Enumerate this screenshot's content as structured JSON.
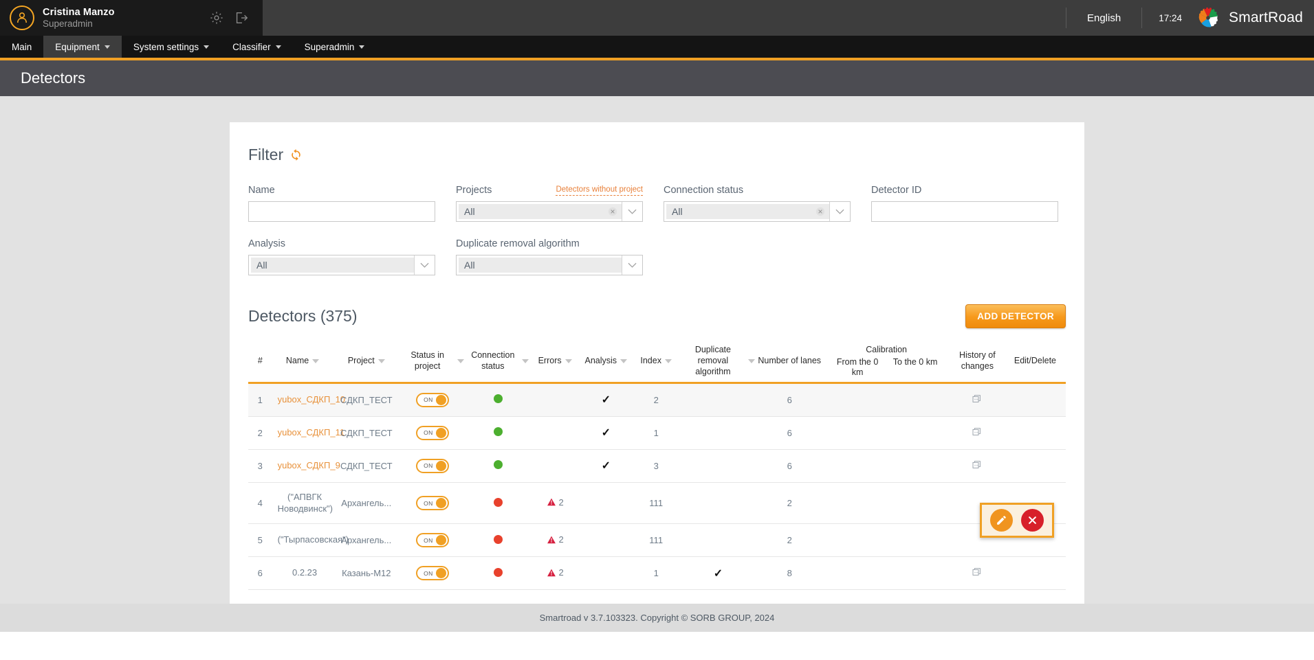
{
  "topbar": {
    "user_name": "Cristina Manzo",
    "user_role": "Superadmin",
    "settings_icon": "gear-icon",
    "logout_icon": "logout-icon",
    "language": "English",
    "time": "17:24",
    "brand": "SmartRoad",
    "brand_logo_icon": "smartroad-gear-logo",
    "accent_color": "#f0a024"
  },
  "nav": {
    "items": [
      {
        "label": "Main",
        "has_caret": false,
        "active": false
      },
      {
        "label": "Equipment",
        "has_caret": true,
        "active": true
      },
      {
        "label": "System settings",
        "has_caret": true,
        "active": false
      },
      {
        "label": "Classifier",
        "has_caret": true,
        "active": false
      },
      {
        "label": "Superadmin",
        "has_caret": true,
        "active": false
      }
    ]
  },
  "page": {
    "title": "Detectors"
  },
  "filter": {
    "title": "Filter",
    "refresh_icon": "refresh-icon",
    "fields": {
      "name": {
        "label": "Name",
        "value": "",
        "placeholder": ""
      },
      "projects": {
        "label": "Projects",
        "value": "All",
        "link_label": "Detectors without project",
        "clearable": true
      },
      "connection_status": {
        "label": "Connection status",
        "value": "All",
        "clearable": true
      },
      "detector_id": {
        "label": "Detector ID",
        "value": "",
        "placeholder": ""
      },
      "analysis": {
        "label": "Analysis",
        "value": "All",
        "clearable": false
      },
      "duplicate_removal": {
        "label": "Duplicate removal algorithm",
        "value": "All",
        "clearable": false
      }
    }
  },
  "detectors": {
    "title": "Detectors (375)",
    "add_button": "ADD DETECTOR",
    "columns": [
      {
        "key": "num",
        "label": "#",
        "sortable": false
      },
      {
        "key": "name",
        "label": "Name",
        "sortable": true
      },
      {
        "key": "project",
        "label": "Project",
        "sortable": true
      },
      {
        "key": "status_in_project",
        "label": "Status in project",
        "sortable": true
      },
      {
        "key": "connection_status",
        "label": "Connection status",
        "sortable": true
      },
      {
        "key": "errors",
        "label": "Errors",
        "sortable": true
      },
      {
        "key": "analysis",
        "label": "Analysis",
        "sortable": true
      },
      {
        "key": "index",
        "label": "Index",
        "sortable": true
      },
      {
        "key": "duplicate_removal",
        "label": "Duplicate removal algorithm",
        "sortable": true
      },
      {
        "key": "lanes",
        "label": "Number of lanes",
        "sortable": false
      },
      {
        "key": "calibration",
        "label": "Calibration",
        "sortable": false,
        "subs": [
          "From the 0 km",
          "To the 0 km"
        ]
      },
      {
        "key": "history",
        "label": "History of changes",
        "sortable": false
      },
      {
        "key": "edit_delete",
        "label": "Edit/Delete",
        "sortable": false
      }
    ],
    "rows": [
      {
        "num": "1",
        "name": "yubox_СДКП_10",
        "name_is_link": true,
        "project": "СДКП_ТЕСТ",
        "toggle": "ON",
        "connection": "green",
        "errors": "",
        "analysis": "check",
        "index": "2",
        "duplicate": "",
        "lanes": "6",
        "cal_from": "",
        "cal_to": "",
        "history_icon": "history-copy-icon",
        "highlighted": true,
        "actions_open": true
      },
      {
        "num": "2",
        "name": "yubox_СДКП_11",
        "name_is_link": true,
        "project": "СДКП_ТЕСТ",
        "toggle": "ON",
        "connection": "green",
        "errors": "",
        "analysis": "check",
        "index": "1",
        "duplicate": "",
        "lanes": "6",
        "cal_from": "",
        "cal_to": "",
        "history_icon": "history-copy-icon",
        "highlighted": false,
        "actions_open": false
      },
      {
        "num": "3",
        "name": "yubox_СДКП_9",
        "name_is_link": true,
        "project": "СДКП_ТЕСТ",
        "toggle": "ON",
        "connection": "green",
        "errors": "",
        "analysis": "check",
        "index": "3",
        "duplicate": "",
        "lanes": "6",
        "cal_from": "",
        "cal_to": "",
        "history_icon": "history-copy-icon",
        "highlighted": false,
        "actions_open": false
      },
      {
        "num": "4",
        "name": "(\"АПВГК Новодвинск\")",
        "name_is_link": false,
        "project": "Архангель...",
        "toggle": "ON",
        "connection": "red",
        "errors": "2",
        "analysis": "",
        "index": "111",
        "duplicate": "",
        "lanes": "2",
        "cal_from": "",
        "cal_to": "",
        "history_icon": "",
        "highlighted": false,
        "actions_open": false
      },
      {
        "num": "5",
        "name": "(\"Тырпасовская\")",
        "name_is_link": false,
        "project": "Архангель...",
        "toggle": "ON",
        "connection": "red",
        "errors": "2",
        "analysis": "",
        "index": "111",
        "duplicate": "",
        "lanes": "2",
        "cal_from": "",
        "cal_to": "",
        "history_icon": "",
        "highlighted": false,
        "actions_open": false
      },
      {
        "num": "6",
        "name": "0.2.23",
        "name_is_link": false,
        "project": "Казань-М12",
        "toggle": "ON",
        "connection": "red",
        "errors": "2",
        "analysis": "",
        "index": "1",
        "duplicate": "check",
        "lanes": "8",
        "cal_from": "",
        "cal_to": "",
        "history_icon": "history-copy-icon",
        "highlighted": false,
        "actions_open": false
      }
    ],
    "row_actions": {
      "edit_icon": "pencil-icon",
      "delete_icon": "close-x-icon"
    }
  },
  "footer": {
    "text": "Smartroad v 3.7.103323. Copyright © SORB GROUP, 2024"
  }
}
